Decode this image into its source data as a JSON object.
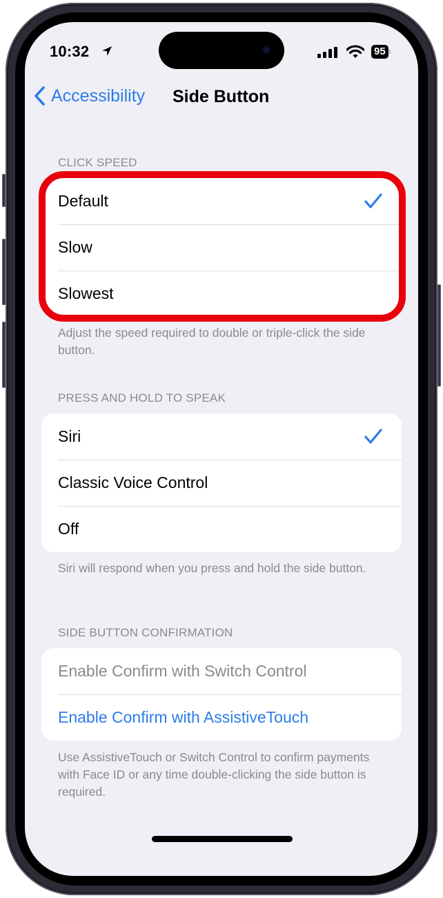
{
  "status_bar": {
    "time": "10:32",
    "location_icon": "location-arrow-icon",
    "signal_icon": "cellular-signal-icon",
    "wifi_icon": "wifi-icon",
    "battery_level": "95"
  },
  "nav": {
    "back_label": "Accessibility",
    "back_icon": "chevron-left-icon",
    "title": "Side Button"
  },
  "sections": [
    {
      "header": "CLICK SPEED",
      "items": [
        {
          "label": "Default",
          "selected": true
        },
        {
          "label": "Slow",
          "selected": false
        },
        {
          "label": "Slowest",
          "selected": false
        }
      ],
      "footer": "Adjust the speed required to double or triple-click the side button."
    },
    {
      "header": "PRESS AND HOLD TO SPEAK",
      "items": [
        {
          "label": "Siri",
          "selected": true
        },
        {
          "label": "Classic Voice Control",
          "selected": false
        },
        {
          "label": "Off",
          "selected": false
        }
      ],
      "footer": "Siri will respond when you press and hold the side button."
    },
    {
      "header": "SIDE BUTTON CONFIRMATION",
      "items": [
        {
          "label": "Enable Confirm with Switch Control",
          "state": "disabled"
        },
        {
          "label": "Enable Confirm with AssistiveTouch",
          "state": "link"
        }
      ],
      "footer": "Use AssistiveTouch or Switch Control to confirm payments with Face ID or any time double-clicking the side button is required."
    }
  ],
  "annotation": {
    "type": "highlight-box",
    "target": "CLICK SPEED options",
    "color": "#e8000c"
  },
  "colors": {
    "accent": "#2b7de9",
    "background": "#f0eff5",
    "secondary_text": "#8a8a8e"
  }
}
